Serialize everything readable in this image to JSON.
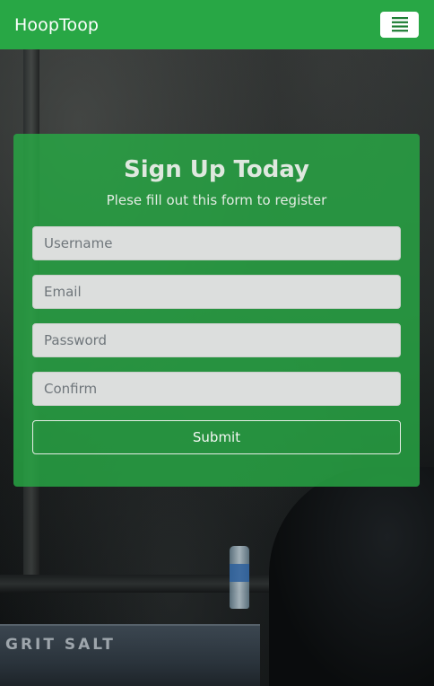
{
  "navbar": {
    "brand": "HoopToop",
    "menu_icon": "hamburger-menu-icon",
    "background": "#28a745"
  },
  "signup": {
    "title": "Sign Up Today",
    "subtitle": "Plese fill out this form to register",
    "fields": {
      "username_placeholder": "Username",
      "email_placeholder": "Email",
      "password_placeholder": "Password",
      "confirm_placeholder": "Confirm"
    },
    "submit_label": "Submit"
  },
  "background_photo": {
    "bucket_text": "GRIT SALT"
  },
  "colors": {
    "accent": "#28a745",
    "input_background": "#dcdedd",
    "text_light": "#ffffff"
  }
}
